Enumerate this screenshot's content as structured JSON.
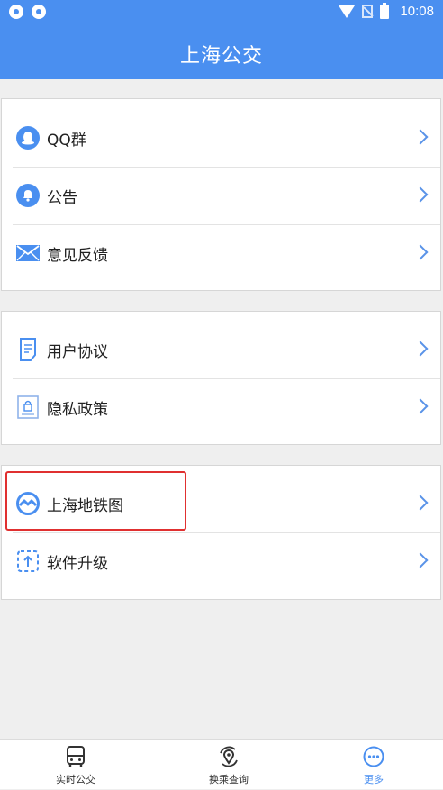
{
  "status_bar": {
    "time": "10:08"
  },
  "header": {
    "title": "上海公交"
  },
  "groups": [
    {
      "items": [
        {
          "label": "QQ群",
          "icon": "qq-icon"
        },
        {
          "label": "公告",
          "icon": "bell-icon"
        },
        {
          "label": "意见反馈",
          "icon": "mail-icon"
        }
      ]
    },
    {
      "items": [
        {
          "label": "用户协议",
          "icon": "document-icon"
        },
        {
          "label": "隐私政策",
          "icon": "lock-document-icon"
        }
      ]
    },
    {
      "items": [
        {
          "label": "上海地铁图",
          "icon": "metro-logo-icon"
        },
        {
          "label": "软件升级",
          "icon": "upgrade-icon"
        }
      ]
    }
  ],
  "tabs": [
    {
      "label": "实时公交",
      "icon": "bus-icon"
    },
    {
      "label": "换乘查询",
      "icon": "location-transfer-icon"
    },
    {
      "label": "更多",
      "icon": "more-icon",
      "active": true
    }
  ],
  "colors": {
    "primary": "#4a8ff0",
    "highlight_box": "#e03030"
  }
}
